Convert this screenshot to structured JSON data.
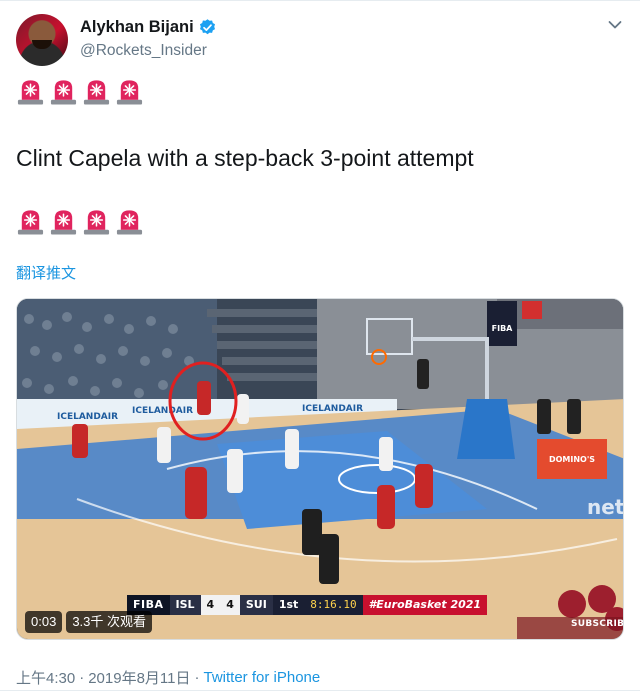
{
  "author": {
    "display_name": "Alykhan Bijani",
    "handle": "@Rockets_Insider",
    "verified": true,
    "avatar_icon": "user-avatar"
  },
  "tweet": {
    "emoji_rows": [
      [
        "rotating-light-emoji",
        "rotating-light-emoji",
        "rotating-light-emoji",
        "rotating-light-emoji"
      ],
      [
        "rotating-light-emoji",
        "rotating-light-emoji",
        "rotating-light-emoji",
        "rotating-light-emoji"
      ]
    ],
    "text": "Clint Capela with a step-back 3-point attempt",
    "translate_label": "翻译推文"
  },
  "media": {
    "duration": "0:03",
    "views": "3.3千 次观看",
    "scoreboard": {
      "league": "FIBA",
      "home_team": "ISL",
      "home_score": "4",
      "away_score": "4",
      "away_team": "SUI",
      "period": "1st",
      "clock": "8:16.10",
      "event": "#EuroBasket 2021"
    },
    "subscribe_label": "SUBSCRIBE",
    "court_ads": [
      "ICELANDAIR",
      "ICELANDAIR",
      "ICELANDAIR",
      "FIBA",
      "DOMINO'S",
      "net"
    ]
  },
  "meta": {
    "time": "上午4:30",
    "separator": "·",
    "date": "2019年8月11日",
    "source": "Twitter for iPhone"
  },
  "colors": {
    "link": "#1b95e0",
    "secondary_text": "#657786",
    "verified_blue": "#1da1f2",
    "siren_red": "#e0245e"
  }
}
